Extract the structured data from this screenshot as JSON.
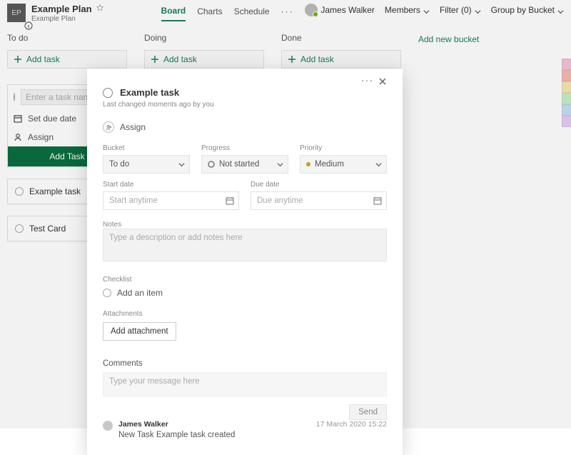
{
  "plan": {
    "initials": "EP",
    "title": "Example Plan",
    "subtitle": "Example Plan"
  },
  "tabs": {
    "board": "Board",
    "charts": "Charts",
    "schedule": "Schedule"
  },
  "topbar": {
    "user": "James Walker",
    "members": "Members",
    "filter": "Filter (0)",
    "groupby": "Group by Bucket"
  },
  "buckets": {
    "todo": "To do",
    "doing": "Doing",
    "done": "Done",
    "addtask": "Add task",
    "addbucket": "Add new bucket"
  },
  "newtask": {
    "placeholder": "Enter a task name",
    "setdue": "Set due date",
    "assign": "Assign",
    "addbtn": "Add Task"
  },
  "cards": {
    "example": "Example task",
    "test": "Test Card"
  },
  "modal": {
    "title": "Example task",
    "subtitle": "Last changed moments ago by you",
    "assign": "Assign",
    "labels": {
      "bucket": "Bucket",
      "progress": "Progress",
      "priority": "Priority",
      "startdate": "Start date",
      "duedate": "Due date",
      "notes": "Notes",
      "checklist": "Checklist",
      "attachments": "Attachments",
      "comments": "Comments"
    },
    "values": {
      "bucket": "To do",
      "progress": "Not started",
      "priority": "Medium"
    },
    "placeholders": {
      "start": "Start anytime",
      "due": "Due anytime",
      "notes": "Type a description or add notes here",
      "checklist_add": "Add an item",
      "attachment_btn": "Add attachment",
      "comment": "Type your message here",
      "send": "Send"
    },
    "activity": {
      "name": "James Walker",
      "date": "17 March 2020 15:22",
      "text": "New Task Example task created"
    }
  }
}
